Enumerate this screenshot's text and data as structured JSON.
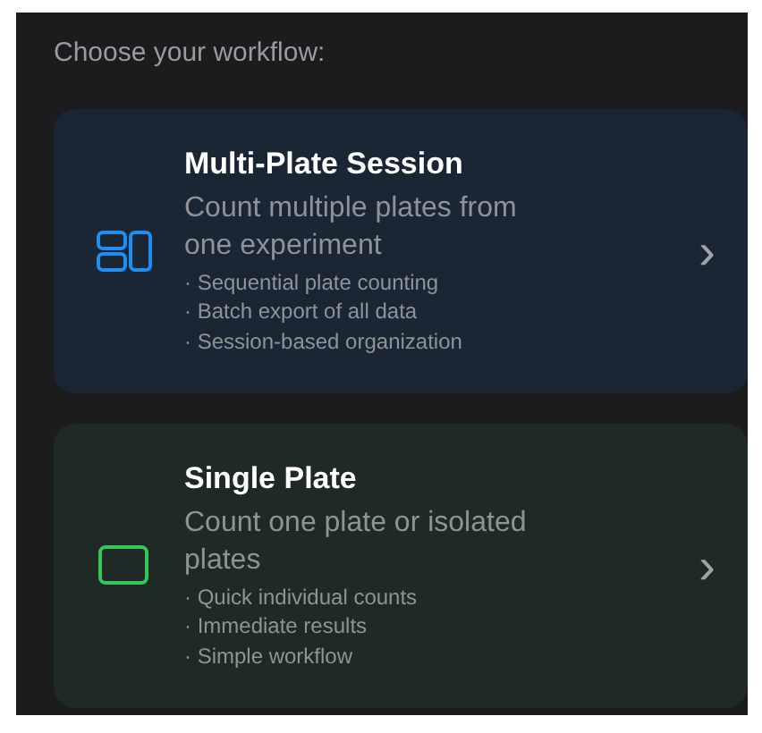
{
  "heading": "Choose your workflow:",
  "options": [
    {
      "kind": "multi",
      "color": "#1f8ef1",
      "title": "Multi-Plate Session",
      "description": "Count multiple plates from one experiment",
      "features": [
        "· Sequential plate counting",
        "· Batch export of all data",
        "· Session-based organization"
      ],
      "chevron": "›"
    },
    {
      "kind": "single",
      "color": "#34c759",
      "title": "Single Plate",
      "description": "Count one plate or isolated plates",
      "features": [
        "· Quick individual counts",
        "· Immediate results",
        "· Simple workflow"
      ],
      "chevron": "›"
    }
  ]
}
